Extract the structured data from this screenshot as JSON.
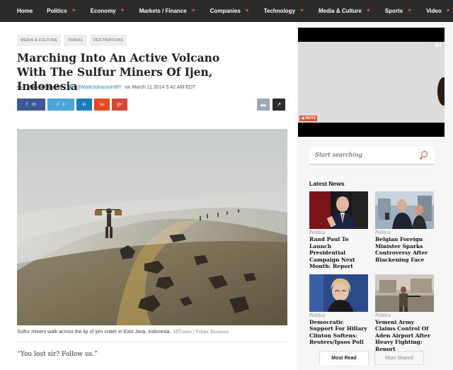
{
  "nav": {
    "items": [
      {
        "label": "Home",
        "caret": false
      },
      {
        "label": "Politics",
        "caret": true
      },
      {
        "label": "Economy",
        "caret": true
      },
      {
        "label": "Markets / Finance",
        "caret": true
      },
      {
        "label": "Companies",
        "caret": true
      },
      {
        "label": "Technology",
        "caret": true
      },
      {
        "label": "Media & Culture",
        "caret": true
      },
      {
        "label": "Sports",
        "caret": true
      },
      {
        "label": "Video",
        "caret": true
      }
    ]
  },
  "article": {
    "tags": [
      "MEDIA & CULTURE",
      "TRAVEL",
      "DESTINATIONS"
    ],
    "title": "Marching Into An Active Volcano With The Sulfur Miners Of Ijen, Indonesia",
    "by_label": "By",
    "author": "Mark Johanson",
    "twitter_handle": "@MarkJohansonIBT",
    "date": "on March 11 2014 5:42 AM EDT",
    "shares": {
      "facebook": {
        "glyph": "f",
        "count": "29"
      },
      "twitter": {
        "glyph": "t",
        "count": "9"
      },
      "linkedin": {
        "glyph": "in"
      },
      "stumbleupon": {
        "glyph": "su"
      },
      "googleplus": {
        "glyph": "g+"
      }
    },
    "caption": "Sulfur miners walk across the lip of Ijen crater in East Java, Indonesia.",
    "credit": "IBTimes / Felipe Basnuan",
    "quote": "“You lost sir? Follow us.”"
  },
  "video": {
    "watermark": "IBT",
    "mute_label": "MUTE"
  },
  "sidebar": {
    "search_placeholder": "Start searching",
    "latest_news_title": "Latest News",
    "news": [
      {
        "category": "Politics",
        "headline": "Rand Paul To Launch Presidential Campaign Next Month: Report"
      },
      {
        "category": "Politics",
        "headline": "Belgian Foreign Minister Sparks Controversy After Blackening Face"
      },
      {
        "category": "Politics",
        "headline": "Democratic Support For Hillary Clinton Softens: Reuters/Ipsos Poll"
      },
      {
        "category": "Politics",
        "headline": "Yemeni Army Claims Control Of Aden Airport After Heavy Fighting: Report"
      }
    ],
    "tabs": {
      "most_read": "Most Read",
      "most_shared": "Most Shared"
    }
  },
  "colors": {
    "nav_bg": "#2b2b2b",
    "accent": "#e2532f",
    "facebook": "#3b5998",
    "twitter": "#4aa6d6",
    "linkedin": "#1a7bbd"
  }
}
